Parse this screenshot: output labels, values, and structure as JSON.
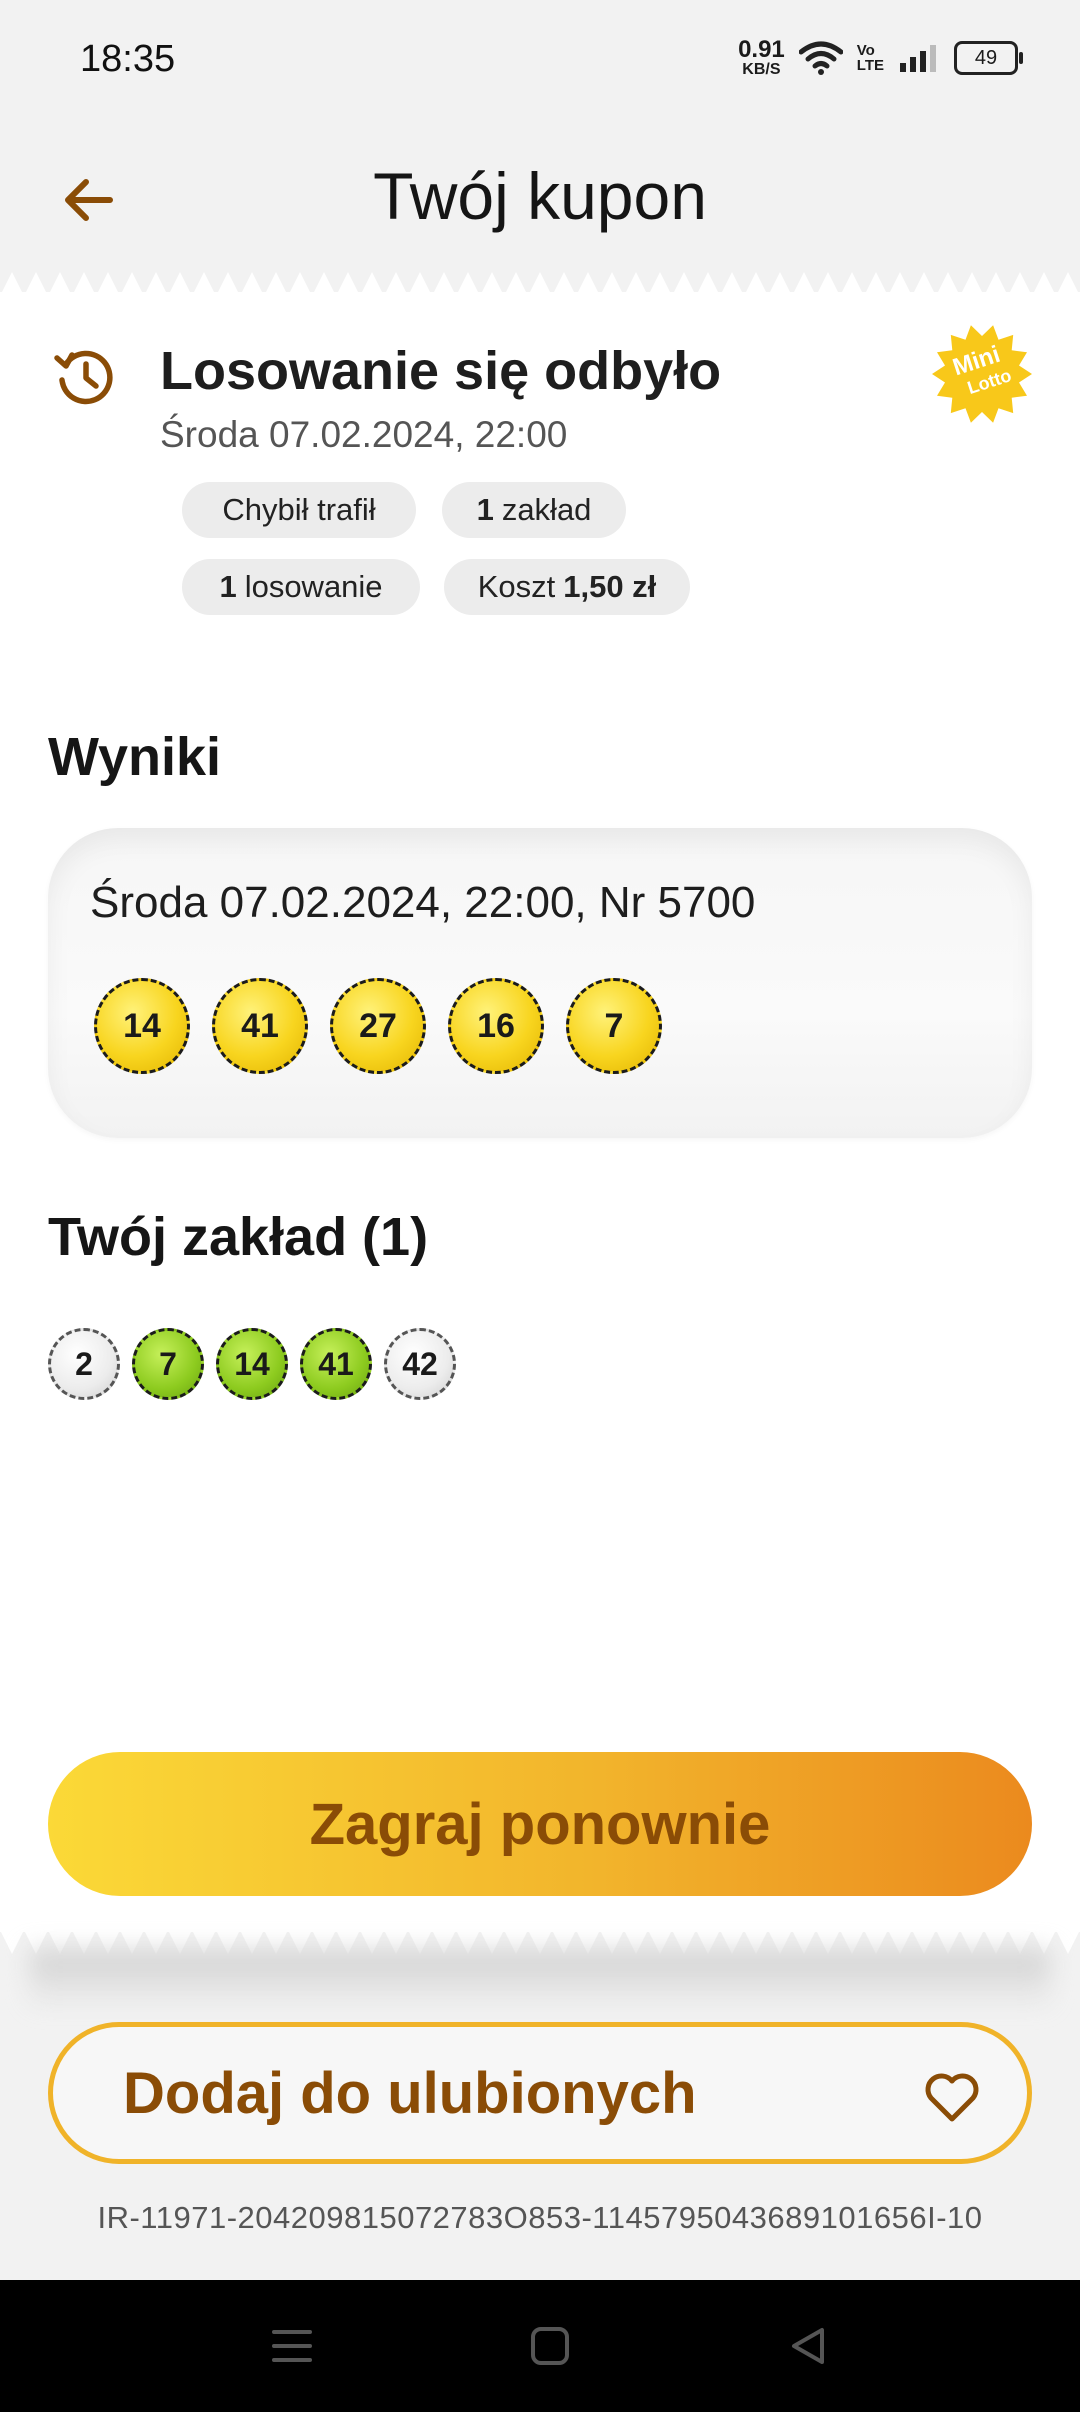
{
  "status_bar": {
    "time": "18:35",
    "net_speed": "0.91",
    "net_unit": "KB/S",
    "volte_top": "Vo",
    "volte_bottom": "LTE",
    "battery": "49"
  },
  "header": {
    "title": "Twój kupon"
  },
  "draw": {
    "status": "Losowanie się odbyło",
    "date": "Środa 07.02.2024, 22:00",
    "logo_top": "Mini",
    "logo_bottom": "Lotto",
    "tags": {
      "quick_pick": "Chybił trafił",
      "bets_count": "1",
      "bets_label": "zakład",
      "draws_count": "1",
      "draws_label": "losowanie",
      "cost_label": "Koszt",
      "cost_value": "1,50 zł"
    }
  },
  "results": {
    "title": "Wyniki",
    "draw_info": "Środa 07.02.2024, 22:00, Nr 5700",
    "numbers": [
      "14",
      "41",
      "27",
      "16",
      "7"
    ]
  },
  "bet": {
    "title": "Twój zakład (1)",
    "numbers": [
      {
        "value": "2",
        "hit": false
      },
      {
        "value": "7",
        "hit": true
      },
      {
        "value": "14",
        "hit": true
      },
      {
        "value": "41",
        "hit": true
      },
      {
        "value": "42",
        "hit": false
      }
    ]
  },
  "actions": {
    "play_again": "Zagraj ponownie",
    "add_favorite": "Dodaj do ulubionych"
  },
  "ticket_id": "IR-11971-204209815072783O853-1145795043689101656I-10",
  "colors": {
    "accent_orange": "#eb8a1e",
    "accent_yellow": "#fbd937",
    "text_brown": "#8a4c06",
    "hit_green": "#8dcb1f"
  }
}
